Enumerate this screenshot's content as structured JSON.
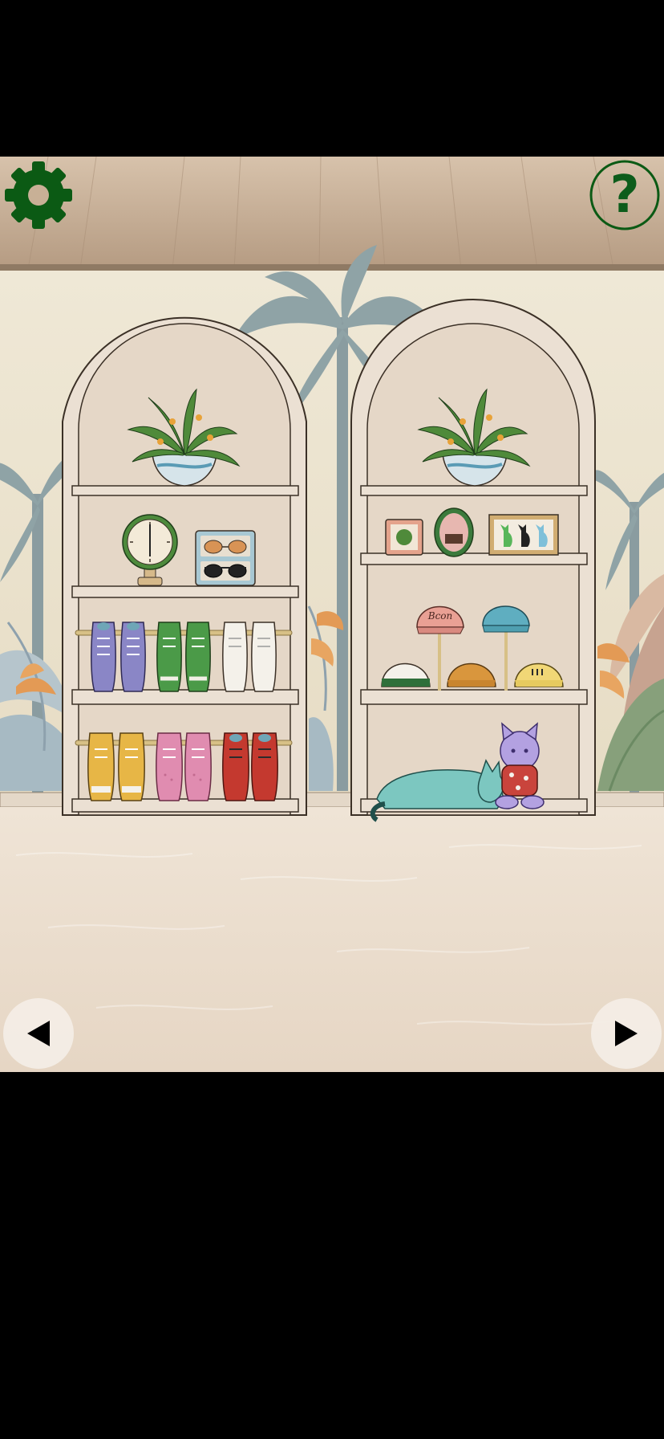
{
  "hud": {
    "settings": {
      "icon": "gear-icon",
      "color": "#0b5a14"
    },
    "help": {
      "label": "?",
      "icon": "question-mark-icon",
      "color": "#0b5a14"
    },
    "nav": {
      "prev_icon": "left-arrow-icon",
      "next_icon": "right-arrow-icon"
    }
  },
  "scene": {
    "room": "shoe-and-cap-shop",
    "left_shelf": {
      "top": [
        "potted-plant"
      ],
      "row1": [
        "clock",
        "sunglasses-case"
      ],
      "row2": [
        "purple-sneakers",
        "green-sneakers",
        "white-sneakers"
      ],
      "row3": [
        "yellow-sneakers",
        "pink-sneakers",
        "red-sneakers"
      ]
    },
    "right_shelf": {
      "top": [
        "potted-plant"
      ],
      "row1": [
        "plant-frame",
        "oval-mirror",
        "cat-picture-frame"
      ],
      "row2": [
        "pink-cap",
        "blue-cap",
        "white-green-cap",
        "orange-cap",
        "yellow-cap"
      ],
      "floor": [
        "teal-cat",
        "purple-cat-plush"
      ]
    },
    "cap_text": "Bcon"
  },
  "colors": {
    "wall": "#ede5d2",
    "ceiling": "#cdb59d",
    "floor": "#ede0d2",
    "shelf": "#e9ddd0",
    "hud_green": "#0b5a14"
  }
}
